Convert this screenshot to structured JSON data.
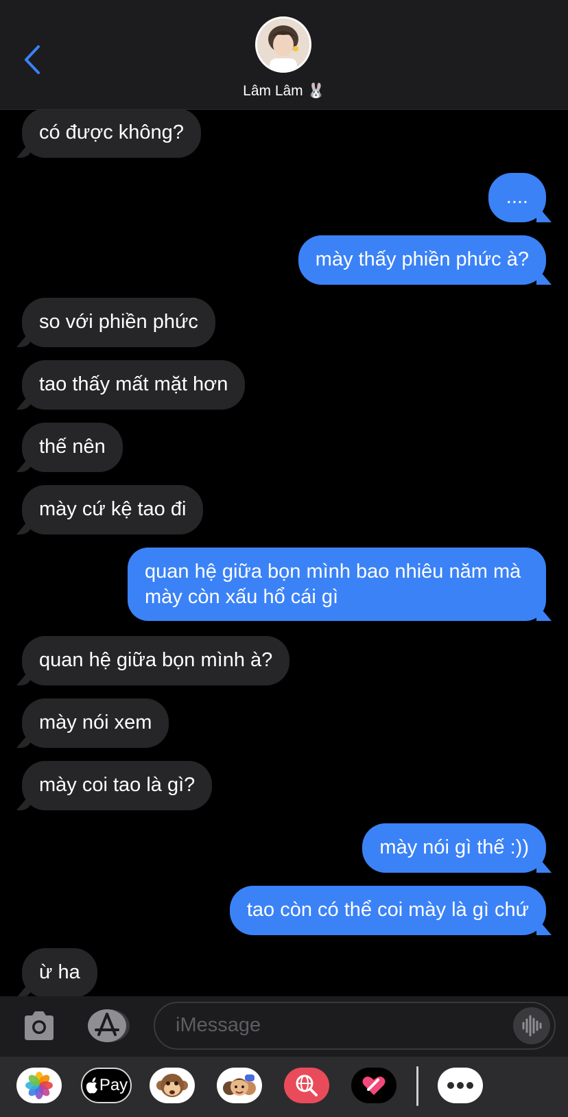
{
  "header": {
    "contact_name": "Lâm Lâm",
    "contact_emoji": "🐰"
  },
  "messages": [
    {
      "dir": "in",
      "text": "có được không?"
    },
    {
      "dir": "out",
      "text": "...."
    },
    {
      "dir": "out",
      "text": "mày thấy phiền phức à?"
    },
    {
      "dir": "in",
      "text": "so với phiền phức"
    },
    {
      "dir": "in",
      "text": "tao thấy mất mặt hơn"
    },
    {
      "dir": "in",
      "text": "thế nên"
    },
    {
      "dir": "in",
      "text": "mày cứ kệ tao đi"
    },
    {
      "dir": "out",
      "text": "quan hệ giữa bọn mình bao nhiêu năm mà mày còn xấu hổ cái gì"
    },
    {
      "dir": "in",
      "text": "quan hệ giữa bọn mình à?"
    },
    {
      "dir": "in",
      "text": "mày nói xem"
    },
    {
      "dir": "in",
      "text": "mày coi tao là gì?"
    },
    {
      "dir": "out",
      "text": "mày nói gì thế :))"
    },
    {
      "dir": "out",
      "text": "tao còn có thể coi mày là gì chứ"
    },
    {
      "dir": "in",
      "text": "ừ ha"
    }
  ],
  "input": {
    "placeholder": "iMessage"
  },
  "app_drawer": {
    "apple_pay_label": "Pay",
    "items": [
      "photos-app",
      "apple-pay-app",
      "animoji-app",
      "memoji-app",
      "images-search-app",
      "digital-touch-app",
      "more-apps"
    ]
  },
  "colors": {
    "incoming_bubble": "#262628",
    "outgoing_bubble": "#3b82f7",
    "accent": "#3b82f7"
  }
}
